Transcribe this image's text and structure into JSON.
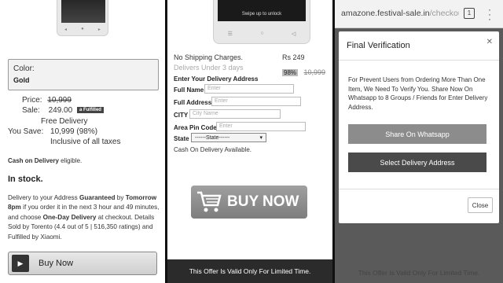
{
  "panel1": {
    "phone_keys": [
      "◂",
      "●",
      "▸"
    ],
    "color_label": "Color:",
    "color_value": "Gold",
    "price_label": "Price:",
    "price_value": "10,999",
    "sale_label": "Sale:",
    "sale_value": "249.00",
    "fulfilled_badge": "Fulfilled",
    "free_delivery": "Free Delivery",
    "you_save_label": "You Save:",
    "you_save_value": "10,999 (98%)",
    "taxes": "Inclusive of all taxes",
    "cod_bold": "Cash on Delivery",
    "cod_rest": " eligible.",
    "in_stock": "In stock.",
    "delivery_text_1": "Delivery to your Address ",
    "guaranteed": "Guaranteed",
    "by": " by ",
    "tomorrow": "Tomorrow 8pm",
    "delivery_text_2": " if you order it in the next 3 hour and 49 minutes, and choose ",
    "one_day": "One-Day Delivery",
    "delivery_text_3": " at checkout. Details Sold by Torento (4.4 out of 5 | 516,350 ratings) and Fulfilled by Xiaomi.",
    "buy_now": "Buy Now"
  },
  "panel2": {
    "swipe_text": "Swipe up to unlock",
    "nav_keys": [
      "☰",
      "○",
      "◁"
    ],
    "no_shipping": "No Shipping Charges.",
    "deliver_days": "Delivers Under 3 days",
    "price": "Rs 249",
    "discount": "98%",
    "old_price": "10,999",
    "form_title": "Enter Your Delivery Address",
    "full_name_label": "Full Name",
    "full_name_ph": "Enter",
    "full_address_label": "Full Address",
    "full_address_ph": "Enter",
    "city_label": "CITY",
    "city_ph": "City Name",
    "pin_label": "Area Pin Code",
    "pin_ph": "Enter",
    "state_label": "State",
    "state_value": "------State------",
    "cod_available": "Cash On Delivery Available.",
    "buy_now": "BUY NOW",
    "offer": "This Offer Is Valid Only For Limited Time."
  },
  "panel3": {
    "url_host": "amazone.festival-sale.in",
    "url_path": "/checkou",
    "tab_count": "1",
    "modal_title": "Final Verification",
    "modal_message": "For Prevent Users from Ordering More Than One Item, We Need To Verify You. Share Now On Whatsapp to 8 Groups / Friends for Enter Delivery Address.",
    "share_button": "Share On Whatsapp",
    "delivery_button": "Select Delivery Address",
    "close_button": "Close",
    "offer": "This Offer Is Valid Only For Limited Time."
  }
}
